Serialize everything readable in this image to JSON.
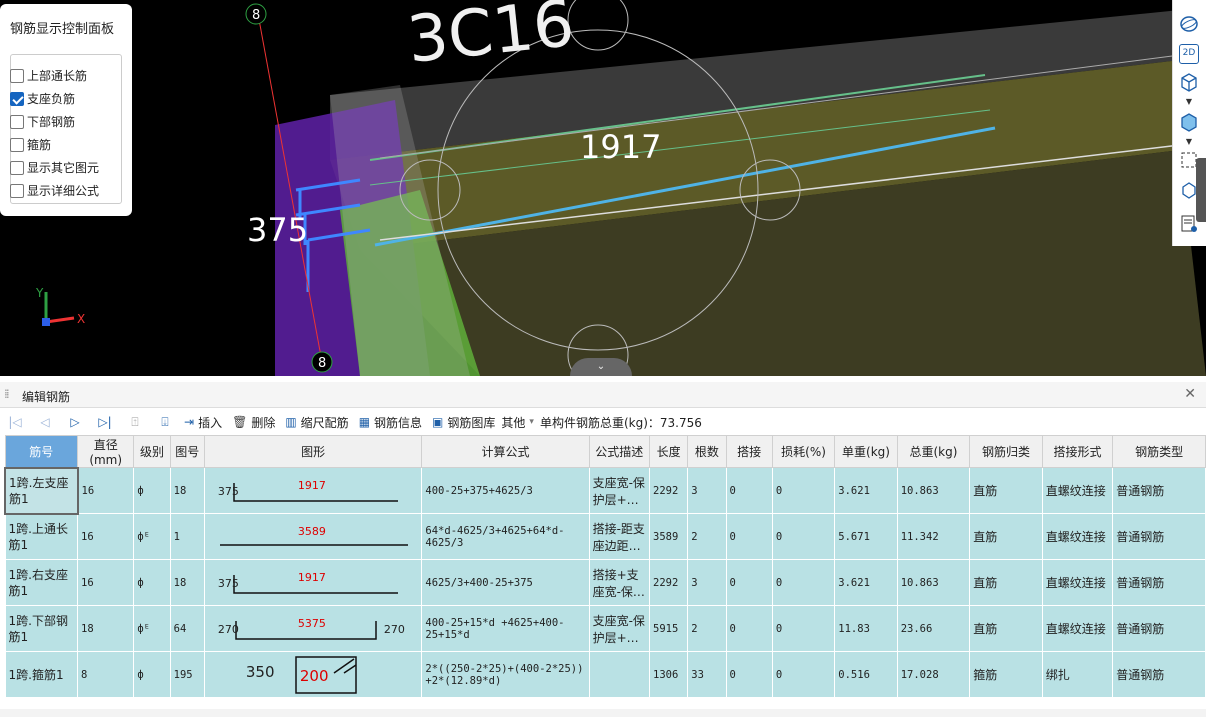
{
  "viewport": {
    "big_label": "3C16",
    "dim_1917": "1917",
    "dim_375": "375",
    "axis_marker_top": "8",
    "axis_marker_bottom": "8",
    "axis_x": "X",
    "axis_y": "Y"
  },
  "panel": {
    "title": "钢筋显示控制面板",
    "options": [
      {
        "label": "上部通长筋",
        "checked": false
      },
      {
        "label": "支座负筋",
        "checked": true
      },
      {
        "label": "下部钢筋",
        "checked": false
      },
      {
        "label": "箍筋",
        "checked": false
      },
      {
        "label": "显示其它图元",
        "checked": false
      },
      {
        "label": "显示详细公式",
        "checked": false
      }
    ]
  },
  "right_toolbar": {
    "items": [
      "sphere-view-icon",
      "2d-view-icon",
      "cube-view-icon",
      "cube-filled-icon",
      "dashed-box-icon",
      "cube-partial-icon",
      "list-eye-icon"
    ],
    "label_2d": "2D"
  },
  "editor": {
    "title": "编辑钢筋",
    "toolbar": {
      "insert": "插入",
      "delete": "删除",
      "scale": "缩尺配筋",
      "info": "钢筋信息",
      "library": "钢筋图库",
      "other": "其他",
      "weight_label": "单构件钢筋总重(kg)：73.756"
    },
    "columns": [
      "筋号",
      "直径(mm)",
      "级别",
      "图号",
      "图形",
      "计算公式",
      "公式描述",
      "长度",
      "根数",
      "搭接",
      "损耗(%)",
      "单重(kg)",
      "总重(kg)",
      "钢筋归类",
      "搭接形式",
      "钢筋类型"
    ],
    "rows": [
      {
        "name": "1跨.左支座筋1",
        "dia": "16",
        "grade": "ф",
        "fig": "18",
        "shape_left": "375",
        "shape_mid": "1917",
        "shape_right": "",
        "formula": "400-25+375+4625/3",
        "desc": "支座宽-保护层+…",
        "len": "2292",
        "count": "3",
        "lap": "0",
        "loss": "0",
        "unit": "3.621",
        "total": "10.863",
        "cat": "直筋",
        "lap_form": "直螺纹连接",
        "type": "普通钢筋"
      },
      {
        "name": "1跨.上通长筋1",
        "dia": "16",
        "grade": "фᴱ",
        "fig": "1",
        "shape_left": "",
        "shape_mid": "3589",
        "shape_right": "",
        "formula": "64*d-4625/3+4625+64*d-4625/3",
        "desc": "搭接-距支座边距…",
        "len": "3589",
        "count": "2",
        "lap": "0",
        "loss": "0",
        "unit": "5.671",
        "total": "11.342",
        "cat": "直筋",
        "lap_form": "直螺纹连接",
        "type": "普通钢筋"
      },
      {
        "name": "1跨.右支座筋1",
        "dia": "16",
        "grade": "ф",
        "fig": "18",
        "shape_left": "375",
        "shape_mid": "1917",
        "shape_right": "",
        "formula": "4625/3+400-25+375",
        "desc": "搭接+支座宽-保…",
        "len": "2292",
        "count": "3",
        "lap": "0",
        "loss": "0",
        "unit": "3.621",
        "total": "10.863",
        "cat": "直筋",
        "lap_form": "直螺纹连接",
        "type": "普通钢筋"
      },
      {
        "name": "1跨.下部钢筋1",
        "dia": "18",
        "grade": "фᴱ",
        "fig": "64",
        "shape_left": "270",
        "shape_mid": "5375",
        "shape_right": "270",
        "formula": "400-25+15*d +4625+400-25+15*d",
        "desc": "支座宽-保护层+…",
        "len": "5915",
        "count": "2",
        "lap": "0",
        "loss": "0",
        "unit": "11.83",
        "total": "23.66",
        "cat": "直筋",
        "lap_form": "直螺纹连接",
        "type": "普通钢筋"
      },
      {
        "name": "1跨.箍筋1",
        "dia": "8",
        "grade": "ф",
        "fig": "195",
        "shape_left": "350",
        "shape_mid": "200",
        "shape_right": "",
        "formula": "2*((250-2*25)+(400-2*25)) +2*(12.89*d)",
        "desc": "",
        "len": "1306",
        "count": "33",
        "lap": "0",
        "loss": "0",
        "unit": "0.516",
        "total": "17.028",
        "cat": "箍筋",
        "lap_form": "绑扎",
        "type": "普通钢筋"
      }
    ]
  }
}
